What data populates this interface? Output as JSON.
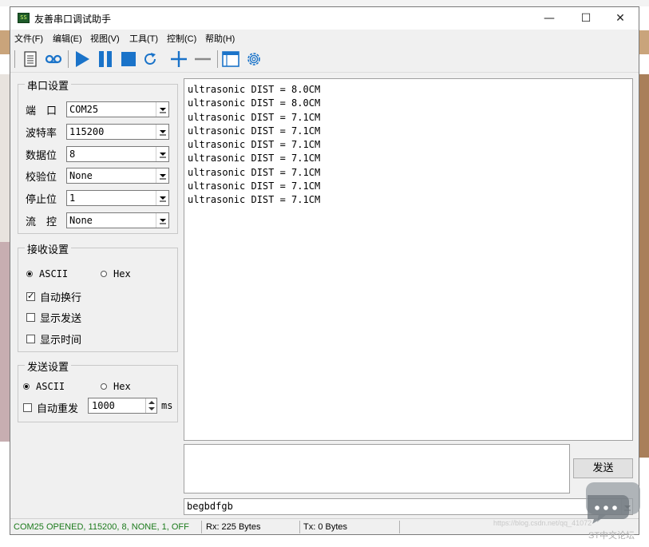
{
  "window": {
    "title": "友善串口调试助手",
    "app_icon_text": "SS"
  },
  "window_controls": {
    "minimize": "—",
    "maximize": "☐",
    "close": "✕"
  },
  "menu": [
    {
      "label": "文件(F)"
    },
    {
      "label": "编辑(E)"
    },
    {
      "label": "视图(V)"
    },
    {
      "label": "工具(T)"
    },
    {
      "label": "控制(C)"
    },
    {
      "label": "帮助(H)"
    }
  ],
  "toolbar": {
    "icons": [
      "document-icon",
      "cassette-icon",
      "play-icon",
      "pause-icon",
      "stop-icon",
      "refresh-icon",
      "plus-icon",
      "minus-icon",
      "window-icon",
      "gear-icon"
    ],
    "accent": "#1a73c9"
  },
  "serial_settings": {
    "title": "串口设置",
    "rows": [
      {
        "label": "端　口",
        "value": "COM25"
      },
      {
        "label": "波特率",
        "value": "115200"
      },
      {
        "label": "数据位",
        "value": "8"
      },
      {
        "label": "校验位",
        "value": "None"
      },
      {
        "label": "停止位",
        "value": "1"
      },
      {
        "label": "流　控",
        "value": "None"
      }
    ]
  },
  "receive_settings": {
    "title": "接收设置",
    "ascii": "ASCII",
    "hex": "Hex",
    "selected": "ASCII",
    "options": [
      {
        "label": "自动换行",
        "checked": true
      },
      {
        "label": "显示发送",
        "checked": false
      },
      {
        "label": "显示时间",
        "checked": false
      }
    ]
  },
  "send_settings": {
    "title": "发送设置",
    "ascii": "ASCII",
    "hex": "Hex",
    "selected": "ASCII",
    "auto_resend_label": "自动重发",
    "auto_resend_checked": false,
    "interval": "1000",
    "unit": "ms"
  },
  "receive_area": {
    "lines": [
      "ultrasonic DIST = 8.0CM",
      "ultrasonic DIST = 8.0CM",
      "ultrasonic DIST = 7.1CM",
      "ultrasonic DIST = 7.1CM",
      "ultrasonic DIST = 7.1CM",
      "ultrasonic DIST = 7.1CM",
      "ultrasonic DIST = 7.1CM",
      "ultrasonic DIST = 7.1CM",
      "ultrasonic DIST = 7.1CM"
    ]
  },
  "send_area": {
    "value": "",
    "button_label": "发送"
  },
  "history": {
    "value": "begbdfgb"
  },
  "status": {
    "port": "COM25 OPENED, 115200, 8, NONE, 1, OFF",
    "port_color": "#1b7a1b",
    "rx": "Rx: 225 Bytes",
    "tx": "Tx: 0 Bytes"
  },
  "watermark": {
    "url": "https://blog.csdn.net/qq_41072",
    "brand": "ST中文论坛"
  }
}
